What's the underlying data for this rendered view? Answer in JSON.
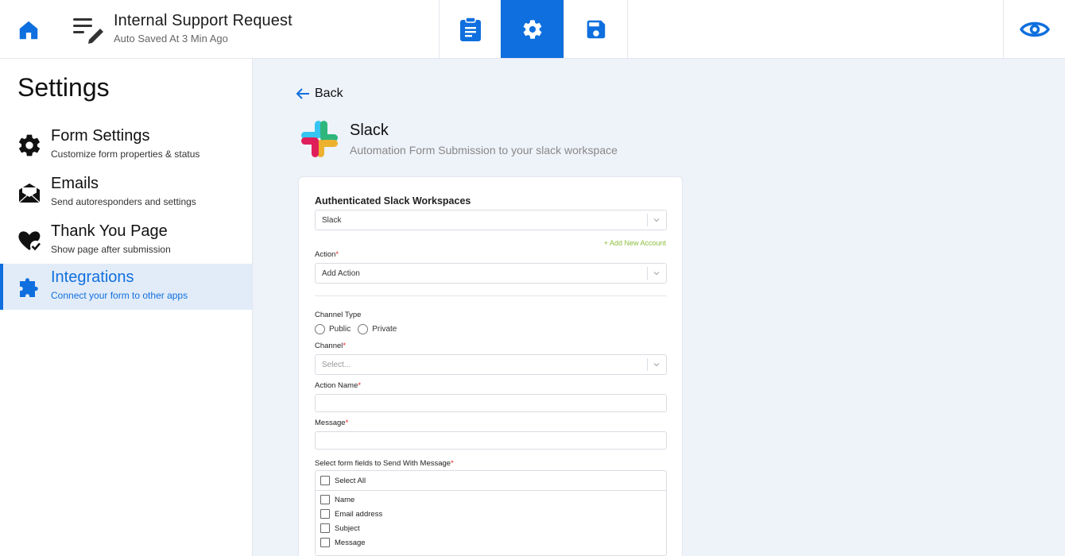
{
  "header": {
    "form_title": "Internal Support Request",
    "autosave": "Auto Saved At 3 Min Ago",
    "icons": [
      "home-icon",
      "form-edit-icon",
      "clipboard-icon",
      "gear-icon",
      "save-icon",
      "eye-icon"
    ],
    "accent": "#0f6fde"
  },
  "sidebar": {
    "title": "Settings",
    "items": [
      {
        "label": "Form Settings",
        "sub": "Customize form properties & status",
        "icon": "gear-icon"
      },
      {
        "label": "Emails",
        "sub": "Send autoresponders and settings",
        "icon": "mail-icon"
      },
      {
        "label": "Thank You Page",
        "sub": "Show page after submission",
        "icon": "heart-check-icon"
      },
      {
        "label": "Integrations",
        "sub": "Connect your form to other apps",
        "icon": "puzzle-icon",
        "active": true
      }
    ]
  },
  "main": {
    "back_label": "Back",
    "integration": {
      "name": "Slack",
      "description": "Automation Form Submission to your slack workspace"
    },
    "form": {
      "workspaces_label": "Authenticated Slack Workspaces",
      "workspace_value": "Slack",
      "add_account": "+ Add New Account",
      "action_label": "Action",
      "action_value": "Add Action",
      "channel_type_label": "Channel Type",
      "channel_types": [
        "Public",
        "Private"
      ],
      "channel_label": "Channel",
      "channel_placeholder": "Select...",
      "action_name_label": "Action Name",
      "action_name_value": "",
      "message_label": "Message",
      "message_value": "",
      "fields_label": "Select form fields to Send With Message",
      "select_all_label": "Select All",
      "fields": [
        "Name",
        "Email address",
        "Subject",
        "Message"
      ],
      "required_mark": "*"
    }
  }
}
